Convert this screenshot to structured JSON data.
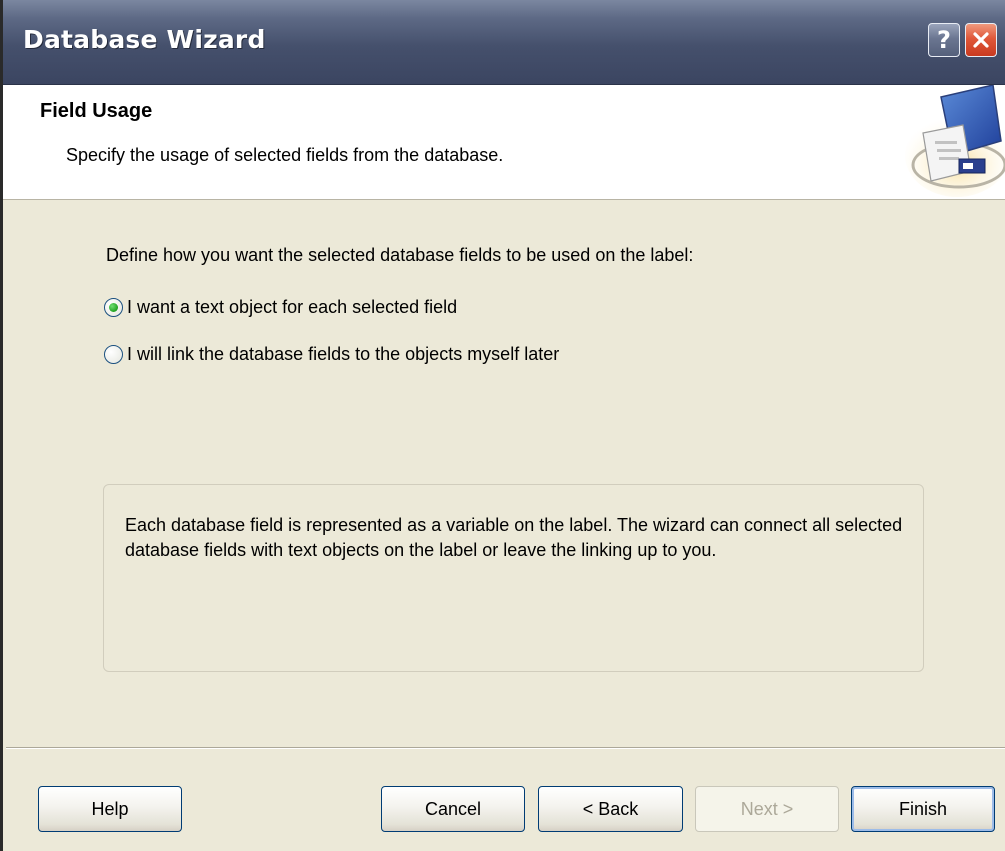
{
  "window": {
    "title": "Database Wizard"
  },
  "title_buttons": {
    "help_label": "?",
    "close_icon": "close-icon"
  },
  "header": {
    "title": "Field Usage",
    "subtitle": "Specify the usage of selected fields from the database.",
    "graphic_icon": "database-wizard-icon"
  },
  "body": {
    "intro": "Define how you want the selected database fields to be used on the label:",
    "options": [
      {
        "label": "I want a text object for each selected field",
        "selected": true
      },
      {
        "label": "I will link the database fields to the objects myself later",
        "selected": false
      }
    ],
    "info_text": "Each database field is represented as a variable on the label. The wizard can connect all selected database fields with text objects on the label or leave the linking up to you."
  },
  "buttons": {
    "help": "Help",
    "cancel": "Cancel",
    "back": "< Back",
    "next": "Next >",
    "finish": "Finish"
  },
  "colors": {
    "titlebar": "#45506c",
    "dialog_background": "#ece9d8",
    "close_button": "#e0583a",
    "radio_selected": "#21a121"
  }
}
